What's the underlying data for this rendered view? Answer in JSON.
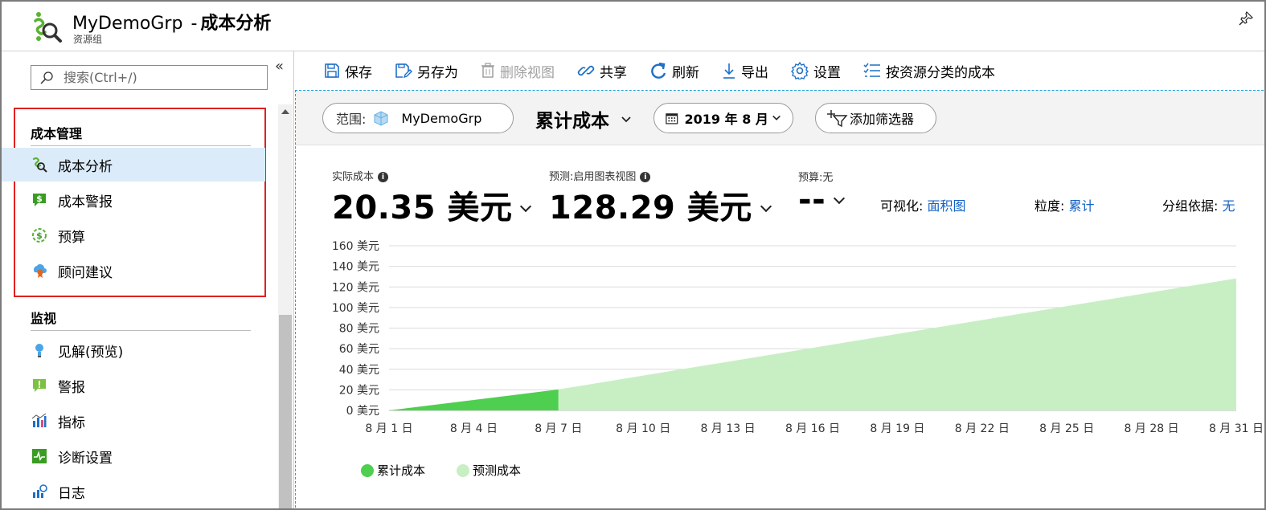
{
  "header": {
    "resource_name": "MyDemoGrp",
    "separator": "-",
    "page_title": "成本分析",
    "subtitle": "资源组"
  },
  "sidebar": {
    "search_placeholder": "搜索(Ctrl+/)",
    "collapse_glyph": "«",
    "sections": [
      {
        "title": "成本管理",
        "items": [
          {
            "label": "成本分析",
            "icon": "cost-analysis-icon",
            "active": true
          },
          {
            "label": "成本警报",
            "icon": "cost-alert-icon"
          },
          {
            "label": "预算",
            "icon": "budget-icon"
          },
          {
            "label": "顾问建议",
            "icon": "advisor-icon"
          }
        ]
      },
      {
        "title": "监视",
        "items": [
          {
            "label": "见解(预览)",
            "icon": "insights-icon"
          },
          {
            "label": "警报",
            "icon": "alerts-icon"
          },
          {
            "label": "指标",
            "icon": "metrics-icon"
          },
          {
            "label": "诊断设置",
            "icon": "diagnostics-icon"
          },
          {
            "label": "日志",
            "icon": "logs-icon"
          }
        ]
      }
    ]
  },
  "toolbar": {
    "save": "保存",
    "save_as": "另存为",
    "delete_view": "删除视图",
    "share": "共享",
    "refresh": "刷新",
    "export": "导出",
    "settings": "设置",
    "cost_by_resource": "按资源分类的成本"
  },
  "filters": {
    "scope_label": "范围:",
    "scope_value": "MyDemoGrp",
    "view": "累计成本",
    "date_range": "2019 年 8 月",
    "add_filter": "添加筛选器"
  },
  "kpis": {
    "actual_label": "实际成本",
    "actual_value": "20.35 美元",
    "forecast_label": "预测:启用图表视图",
    "forecast_value": "128.29 美元",
    "budget_label": "预算:无",
    "budget_value": "--"
  },
  "chart_options": {
    "visualization_label": "可视化:",
    "visualization_value": "面积图",
    "granularity_label": "粒度:",
    "granularity_value": "累计",
    "group_by_label": "分组依据:",
    "group_by_value": "无"
  },
  "colors": {
    "accumulated": "#4fcf4f",
    "forecast": "#c8efc4",
    "link": "#1462c4",
    "highlight_box": "#e02020"
  },
  "chart_data": {
    "type": "area",
    "x_ticks": [
      "8 月 1 日",
      "8 月 4 日",
      "8 月 7 日",
      "8 月 10 日",
      "8 月 13 日",
      "8 月 16 日",
      "8 月 19 日",
      "8 月 22 日",
      "8 月 25 日",
      "8 月 28 日",
      "8 月 31 日"
    ],
    "y_ticks": [
      "0 美元",
      "20 美元",
      "40 美元",
      "60 美元",
      "80 美元",
      "100 美元",
      "120 美元",
      "140 美元",
      "160 美元"
    ],
    "ylim": [
      0,
      160
    ],
    "xlim": [
      1,
      31
    ],
    "series": [
      {
        "name": "累计成本",
        "color": "#4fcf4f",
        "points": [
          [
            1,
            0
          ],
          [
            7,
            20.35
          ]
        ]
      },
      {
        "name": "预测成本",
        "color": "#c8efc4",
        "points": [
          [
            7,
            20.35
          ],
          [
            31,
            128.29
          ]
        ]
      }
    ],
    "grid": true,
    "legend_position": "bottom-left"
  }
}
